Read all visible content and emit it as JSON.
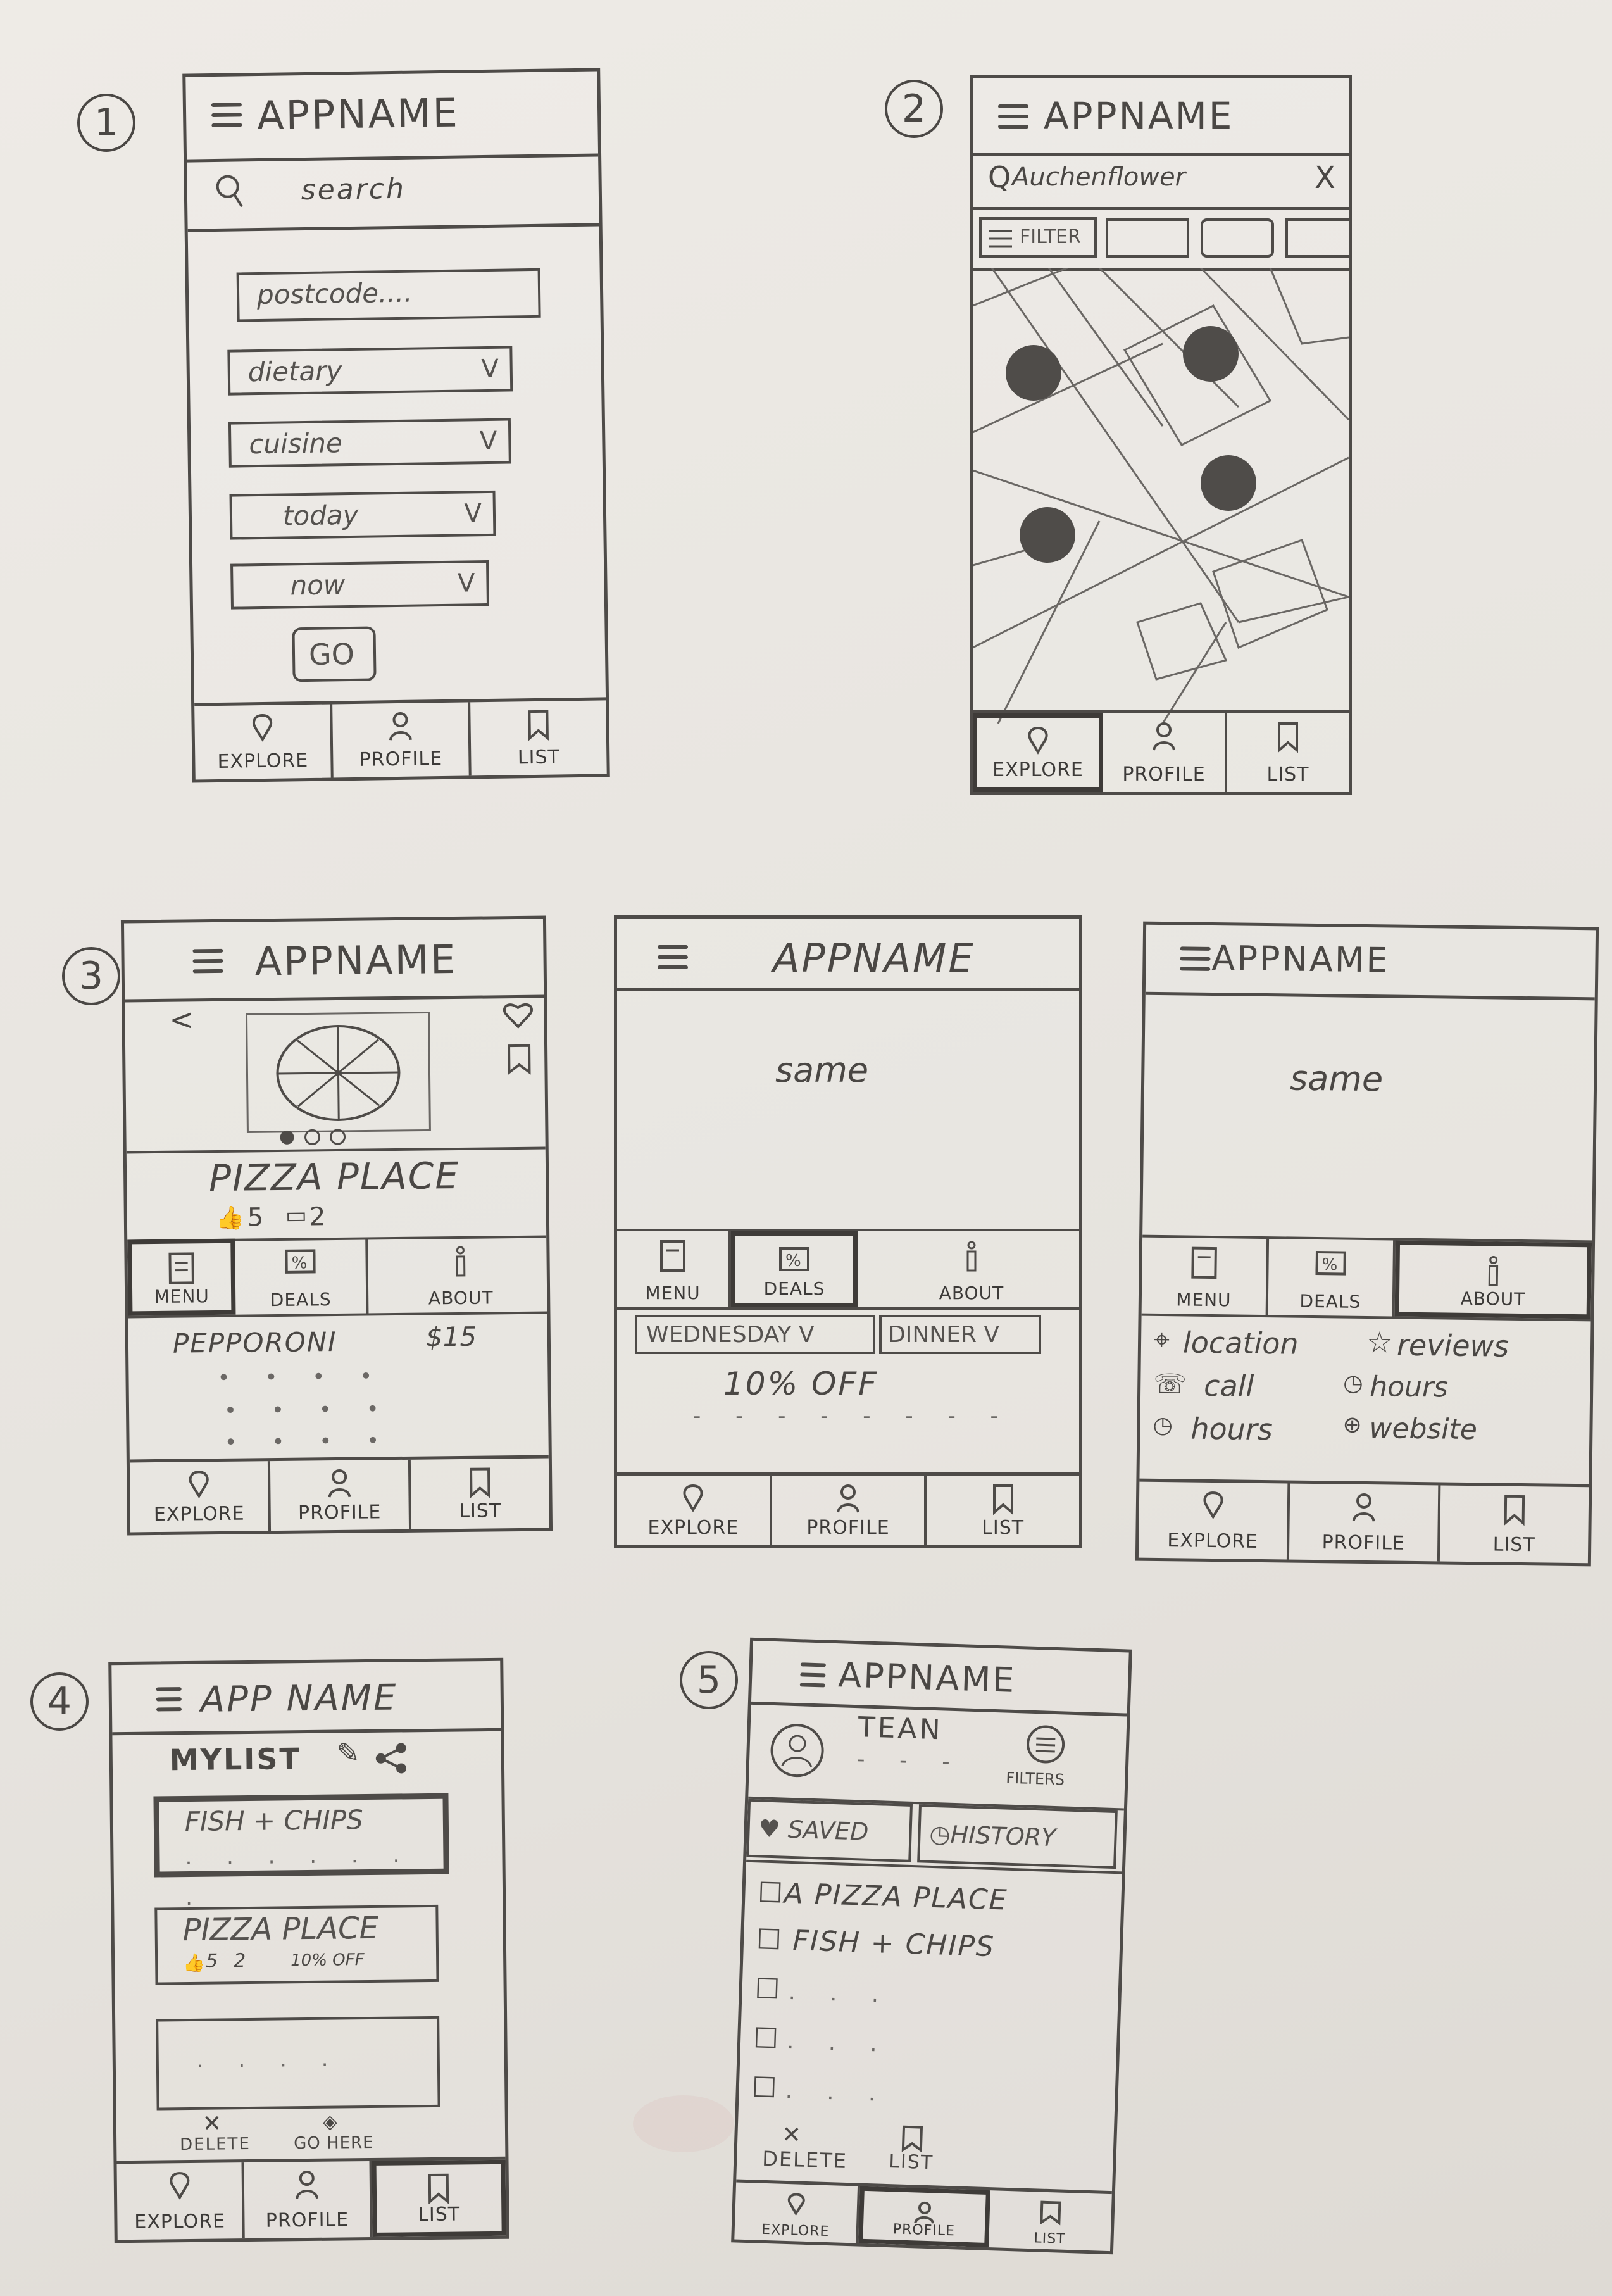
{
  "app_name": "APPNAME",
  "app_name_spaced": "APP NAME",
  "numbers": [
    "1",
    "2",
    "3",
    "4",
    "5"
  ],
  "nav": {
    "explore": "EXPLORE",
    "profile": "PROFILE",
    "list": "LIST"
  },
  "s1": {
    "search": "search",
    "postcode": "postcode....",
    "dietary": "dietary",
    "cuisine": "cuisine",
    "today": "today",
    "now": "now",
    "chev": "V",
    "go": "GO"
  },
  "s2": {
    "search": "Auchenflower",
    "close": "X",
    "filter": "FILTER"
  },
  "s3a": {
    "back": "<",
    "place": "PIZZA PLACE",
    "likes": "5",
    "comments": "2",
    "tabs": {
      "menu": "MENU",
      "deals": "DEALS",
      "about": "ABOUT"
    },
    "item": "PEPPORONI",
    "price": "$15"
  },
  "s3b": {
    "same": "same",
    "day": "WEDNESDAY V",
    "meal": "DINNER V",
    "deal": "10% OFF"
  },
  "s3c": {
    "same": "same",
    "location": "location",
    "reviews": "reviews",
    "call": "call",
    "hours": "hours",
    "hours2": "hours",
    "website": "website"
  },
  "s4": {
    "mylist": "MYLIST",
    "item1": "FISH + CHIPS",
    "item2": "PIZZA PLACE",
    "item2_likes": "5",
    "item2_comments": "2",
    "item2_deal": "10% OFF",
    "delete": "DELETE",
    "gohere": "GO HERE"
  },
  "s5": {
    "name": "TEAN",
    "filters": "FILTERS",
    "saved": "SAVED",
    "history": "HISTORY",
    "items": [
      "A PIZZA PLACE",
      "FISH + CHIPS"
    ],
    "delete": "DELETE",
    "list": "LIST"
  }
}
